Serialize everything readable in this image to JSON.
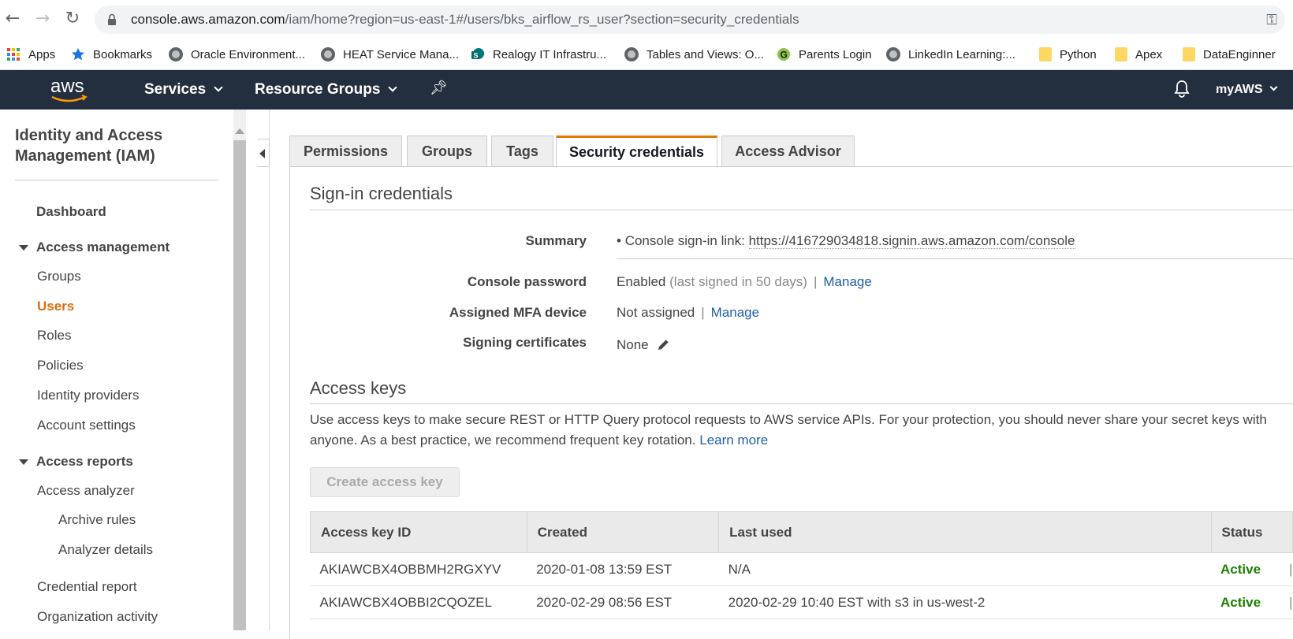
{
  "browser": {
    "url_host": "console.aws.amazon.com",
    "url_path": "/iam/home?region=us-east-1#/users/bks_airflow_rs_user?section=security_credentials",
    "bookmarks": [
      {
        "label": "Apps",
        "icon": "apps-grid-icon"
      },
      {
        "label": "Bookmarks",
        "icon": "star-icon"
      },
      {
        "label": "Oracle Environment...",
        "icon": "globe-icon"
      },
      {
        "label": "HEAT Service Mana...",
        "icon": "globe-icon"
      },
      {
        "label": "Realogy IT Infrastru...",
        "icon": "sharepoint-icon"
      },
      {
        "label": "Tables and Views: O...",
        "icon": "globe-icon"
      },
      {
        "label": "Parents Login",
        "icon": "g-logo-icon"
      },
      {
        "label": "LinkedIn Learning:...",
        "icon": "globe-icon"
      },
      {
        "label": "Python",
        "icon": "folder-icon"
      },
      {
        "label": "Apex",
        "icon": "folder-icon"
      },
      {
        "label": "DataEnginner",
        "icon": "folder-icon"
      }
    ]
  },
  "aws_nav": {
    "logo_text": "aws",
    "services": "Services",
    "resource_groups": "Resource Groups",
    "account": "myAWS"
  },
  "sidebar": {
    "title": "Identity and Access Management (IAM)",
    "dashboard": "Dashboard",
    "access_management": "Access management",
    "groups": "Groups",
    "users": "Users",
    "roles": "Roles",
    "policies": "Policies",
    "identity_providers": "Identity providers",
    "account_settings": "Account settings",
    "access_reports": "Access reports",
    "access_analyzer": "Access analyzer",
    "archive_rules": "Archive rules",
    "analyzer_details": "Analyzer details",
    "credential_report": "Credential report",
    "organization_activity": "Organization activity"
  },
  "tabs": [
    "Permissions",
    "Groups",
    "Tags",
    "Security credentials",
    "Access Advisor"
  ],
  "signin": {
    "heading": "Sign-in credentials",
    "summary_label": "Summary",
    "summary_prefix": "Console sign-in link:",
    "summary_link": "https://416729034818.signin.aws.amazon.com/console",
    "console_password_label": "Console password",
    "console_password_value": "Enabled",
    "console_password_note": "(last signed in 50 days)",
    "manage": "Manage",
    "mfa_label": "Assigned MFA device",
    "mfa_value": "Not assigned",
    "signing_label": "Signing certificates",
    "signing_value": "None"
  },
  "access_keys": {
    "heading": "Access keys",
    "description": "Use access keys to make secure REST or HTTP Query protocol requests to AWS service APIs. For your protection, you should never share your secret keys with anyone. As a best practice, we recommend frequent key rotation.",
    "learn_more": "Learn more",
    "create_button": "Create access key",
    "columns": [
      "Access key ID",
      "Created",
      "Last used",
      "Status"
    ],
    "rows": [
      {
        "id": "AKIAWCBX4OBBMH2RGXYV",
        "created": "2020-01-08 13:59 EST",
        "last_used": "N/A",
        "status": "Active"
      },
      {
        "id": "AKIAWCBX4OBBI2CQOZEL",
        "created": "2020-02-29 08:56 EST",
        "last_used": "2020-02-29 10:40 EST with s3 in us-west-2",
        "status": "Active"
      }
    ]
  }
}
